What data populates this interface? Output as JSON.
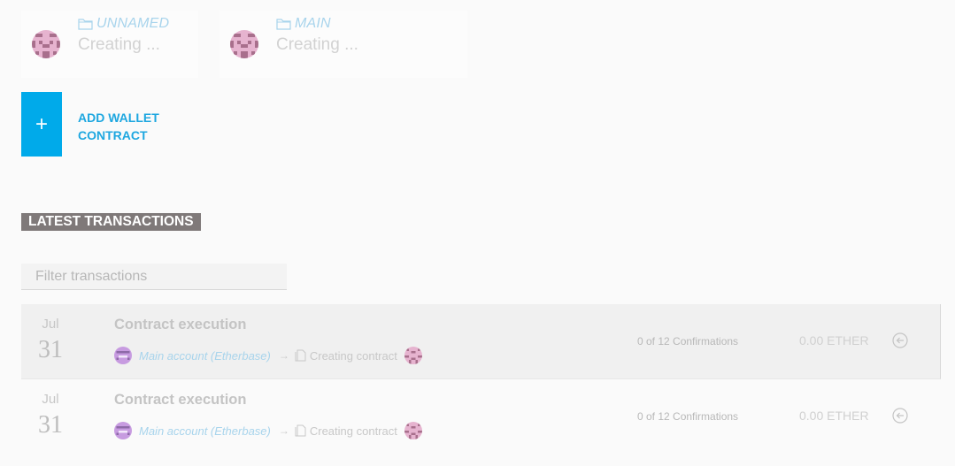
{
  "wallets": [
    {
      "name": "UNNAMED",
      "status": "Creating ..."
    },
    {
      "name": "MAIN",
      "status": "Creating ..."
    }
  ],
  "add_wallet": {
    "icon": "+",
    "label": "ADD WALLET CONTRACT"
  },
  "transactions_section": {
    "title": "LATEST TRANSACTIONS",
    "filter_placeholder": "Filter transactions"
  },
  "transactions": [
    {
      "month": "Jul",
      "day": "31",
      "type": "Contract execution",
      "from": "Main account (Etherbase)",
      "arrow": "→",
      "to": "Creating contract",
      "confirmations": "0 of 12 Confirmations",
      "amount": "0.00 ETHER"
    },
    {
      "month": "Jul",
      "day": "31",
      "type": "Contract execution",
      "from": "Main account (Etherbase)",
      "arrow": "→",
      "to": "Creating contract",
      "confirmations": "0 of 12 Confirmations",
      "amount": "0.00 ETHER"
    }
  ],
  "icons": {
    "wallet_identicon": "identicon-pink",
    "account_identicon": "identicon-purple",
    "folder": "folder-icon",
    "document": "document-icon",
    "details": "arrow-circle-left-icon"
  },
  "colors": {
    "accent": "#00aaea",
    "link": "#a8d4ec",
    "section_bg": "#7f7979",
    "identicon_pink": "#e6b3cf",
    "identicon_dark": "#a86f8c",
    "identicon_purple": "#c79be0"
  }
}
